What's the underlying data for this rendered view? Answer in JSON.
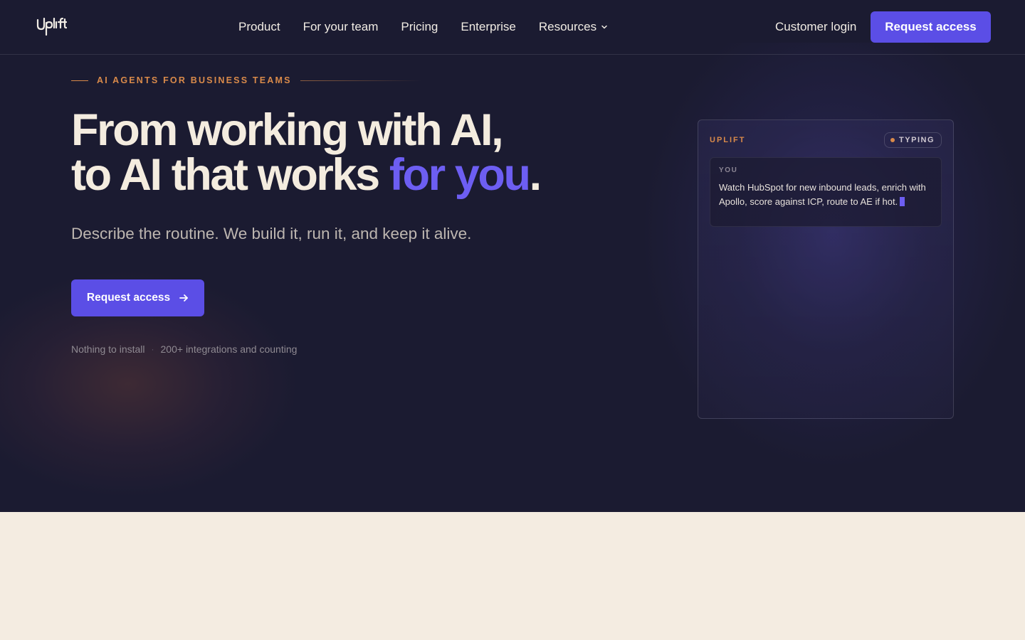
{
  "nav": {
    "logo_text": "Uplift",
    "links": [
      {
        "label": "Product"
      },
      {
        "label": "For your team"
      },
      {
        "label": "Pricing"
      },
      {
        "label": "Enterprise"
      },
      {
        "label": "Resources"
      }
    ],
    "customer_login": "Customer login",
    "cta": "Request access"
  },
  "hero": {
    "eyebrow": "AI AGENTS FOR BUSINESS TEAMS",
    "headline_line1": "From working with AI,",
    "headline_line2_main": "to AI that works ",
    "headline_line2_accent": "for you",
    "headline_line2_end": ".",
    "subhead": "Describe the routine. We build it, run it, and keep it alive.",
    "cta": "Request access",
    "footnote_1": "Nothing to install",
    "footnote_sep": "·",
    "footnote_2": "200+ integrations and counting"
  },
  "card": {
    "brand": "UPLIFT",
    "status": "TYPING",
    "message_label": "YOU",
    "message_text": "Watch HubSpot for new inbound leads, enrich with Apollo, score against ICP, route to AE if hot."
  },
  "colors": {
    "hero_bg": "#1b1b31",
    "accent": "#5b4ee6",
    "accent_text": "#6d5ef2",
    "eyebrow": "#d98a4a",
    "page_bg": "#f4ece1"
  },
  "icons": {
    "logo": "uplift-logo",
    "resources_chevron": "chevron-down-icon",
    "cta_arrow": "arrow-right-icon"
  }
}
